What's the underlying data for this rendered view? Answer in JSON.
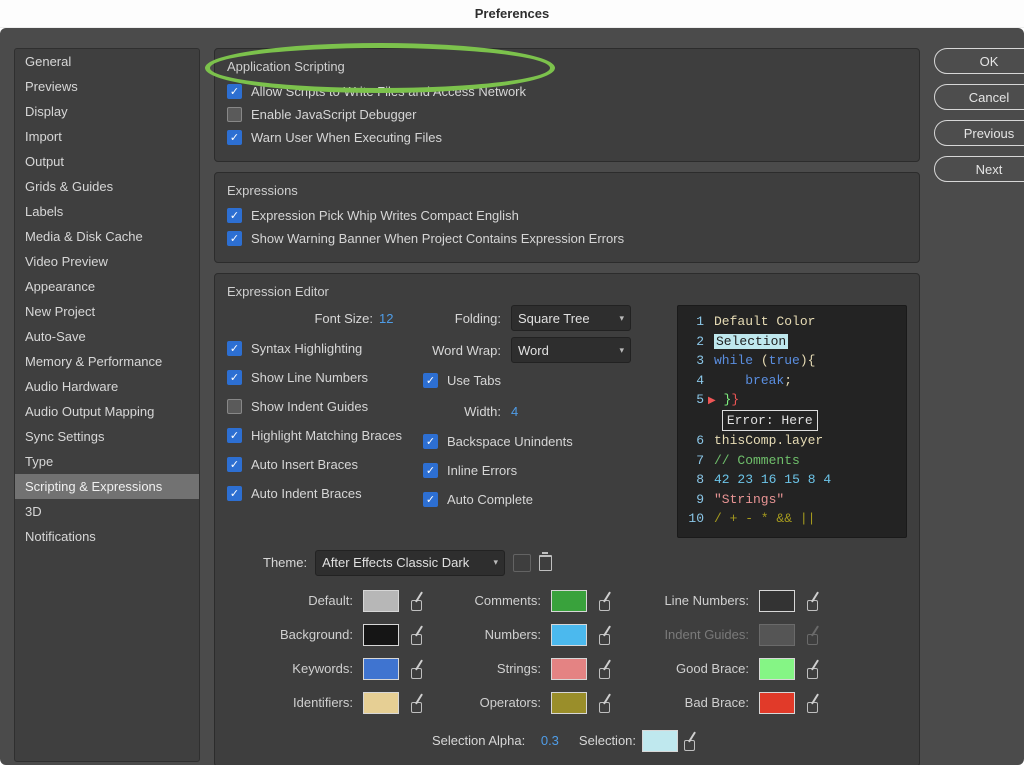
{
  "title": "Preferences",
  "buttons": {
    "ok": "OK",
    "cancel": "Cancel",
    "previous": "Previous",
    "next": "Next"
  },
  "sidebar": {
    "items": [
      "General",
      "Previews",
      "Display",
      "Import",
      "Output",
      "Grids & Guides",
      "Labels",
      "Media & Disk Cache",
      "Video Preview",
      "Appearance",
      "New Project",
      "Auto-Save",
      "Memory & Performance",
      "Audio Hardware",
      "Audio Output Mapping",
      "Sync Settings",
      "Type",
      "Scripting & Expressions",
      "3D",
      "Notifications"
    ],
    "active": 17
  },
  "app_scripting": {
    "title": "Application Scripting",
    "allow_write": "Allow Scripts to Write Files and Access Network",
    "enable_debugger": "Enable JavaScript Debugger",
    "warn_exec": "Warn User When Executing Files"
  },
  "expressions": {
    "title": "Expressions",
    "pick_whip": "Expression Pick Whip Writes Compact English",
    "warn_banner": "Show Warning Banner When Project Contains Expression Errors"
  },
  "editor": {
    "title": "Expression Editor",
    "font_size_label": "Font Size:",
    "font_size": "12",
    "folding_label": "Folding:",
    "folding_value": "Square Tree",
    "wrap_label": "Word Wrap:",
    "wrap_value": "Word",
    "use_tabs": "Use Tabs",
    "width_label": "Width:",
    "width_value": "4",
    "backspace": "Backspace Unindents",
    "inline_errors": "Inline Errors",
    "auto_complete": "Auto Complete",
    "syntax_hl": "Syntax Highlighting",
    "line_numbers": "Show Line Numbers",
    "indent_guides": "Show Indent Guides",
    "match_braces": "Highlight Matching Braces",
    "auto_insert_braces": "Auto Insert Braces",
    "auto_indent_braces": "Auto Indent Braces"
  },
  "code": {
    "l1": "Default Color",
    "l2": "Selection",
    "l3a": "while",
    "l3b": "(",
    "l3c": "true",
    "l3d": "){",
    "l4": "break",
    "l5a": "}",
    "l5b": "}",
    "l5err": "Error: Here",
    "l6a": "thisComp",
    "l6b": ".layer",
    "l7": "// Comments",
    "l8": [
      "42",
      "23",
      "16",
      "15",
      "8",
      "4"
    ],
    "l9": "\"Strings\"",
    "l10": "/ + - * && ||"
  },
  "theme": {
    "label": "Theme:",
    "value": "After Effects Classic Dark",
    "rows": [
      {
        "a": "Default:",
        "ac": "#b7b7b7",
        "b": "Comments:",
        "bc": "#39a23c",
        "c": "Line Numbers:",
        "cc": "#333333",
        "dim_c": false
      },
      {
        "a": "Background:",
        "ac": "#151515",
        "b": "Numbers:",
        "bc": "#4bb9ee",
        "c": "Indent Guides:",
        "cc": "#555555",
        "dim_c": true
      },
      {
        "a": "Keywords:",
        "ac": "#3f74d0",
        "b": "Strings:",
        "bc": "#e48383",
        "c": "Good Brace:",
        "cc": "#85f585",
        "dim_c": false
      },
      {
        "a": "Identifiers:",
        "ac": "#e6cf94",
        "b": "Operators:",
        "bc": "#9a8e2a",
        "c": "Bad Brace:",
        "cc": "#e13a29",
        "dim_c": false
      }
    ],
    "sel_alpha_label": "Selection Alpha:",
    "sel_alpha": "0.3",
    "selection_label": "Selection:",
    "selection_color": "#bfe8ee"
  }
}
